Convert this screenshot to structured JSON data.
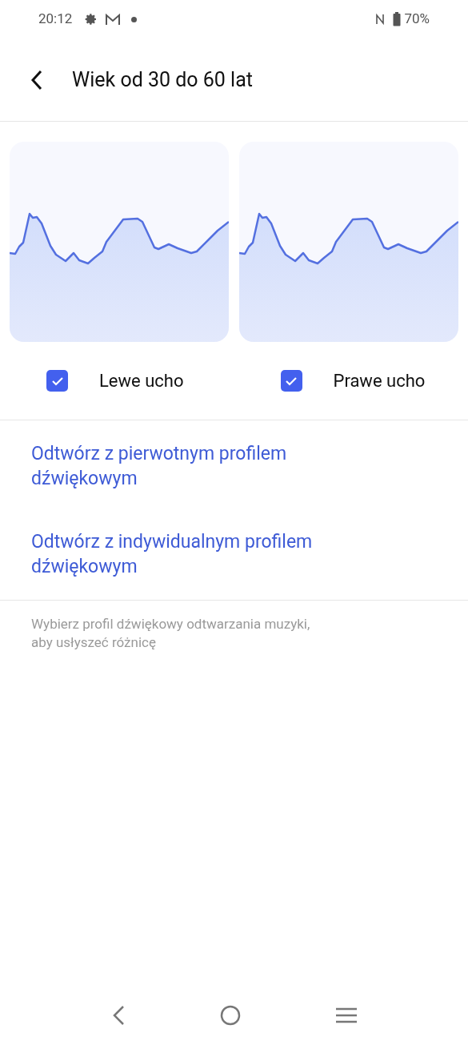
{
  "status_bar": {
    "time": "20:12",
    "battery": "70%"
  },
  "header": {
    "title": "Wiek od 30 do 60 lat"
  },
  "ears": [
    {
      "label": "Lewe ucho",
      "checked": true
    },
    {
      "label": "Prawe ucho",
      "checked": true
    }
  ],
  "links": [
    "Odtwórz z pierwotnym profilem dźwiękowym",
    "Odtwórz z indywidualnym profilem dźwiękowym"
  ],
  "hint": "Wybierz profil dźwiękowy odtwarzania muzyki, aby usłyszeć różnicę"
}
